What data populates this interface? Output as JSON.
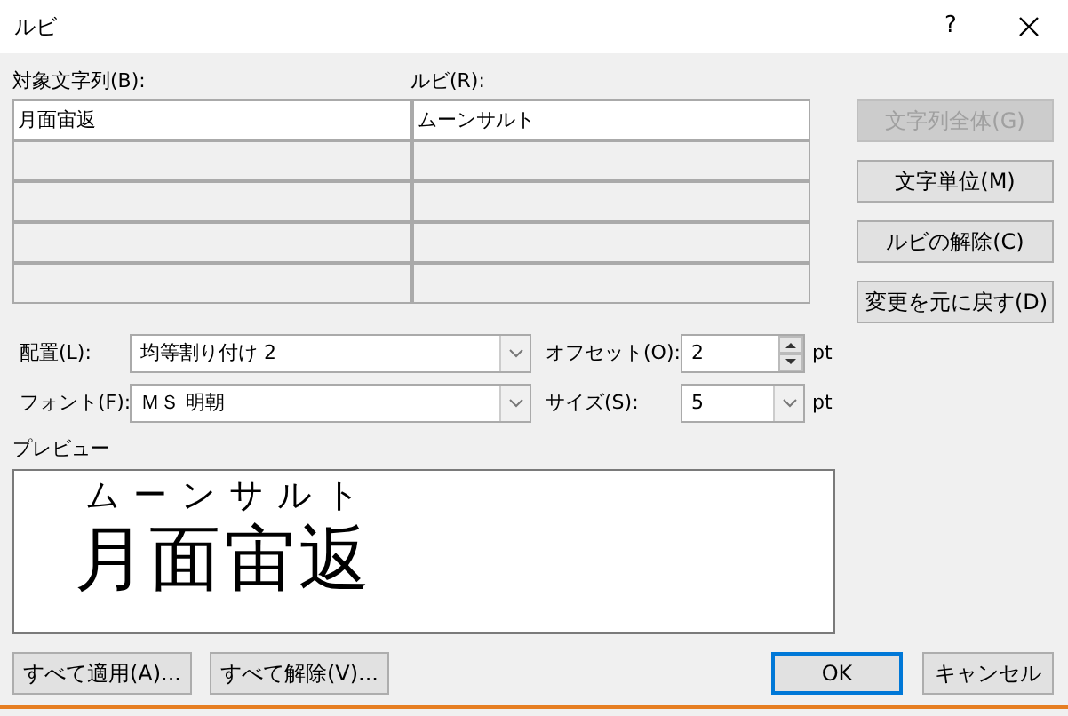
{
  "window": {
    "title": "ルビ",
    "help": "?"
  },
  "table": {
    "columns": [
      "対象文字列(B):",
      "ルビ(R):"
    ],
    "rows": [
      {
        "base": "月面宙返",
        "ruby": "ムーンサルト",
        "selected": true
      },
      {
        "selected": false
      },
      {
        "selected": false
      },
      {
        "selected": false
      },
      {
        "selected": false
      }
    ]
  },
  "side_buttons": [
    {
      "label": "文字列全体(G)",
      "disabled": true
    },
    {
      "label": "文字単位(M)",
      "disabled": false
    },
    {
      "label": "ルビの解除(C)",
      "disabled": false
    },
    {
      "label": "変更を元に戻す(D)",
      "disabled": false
    }
  ],
  "alignment": {
    "label": "配置(L):",
    "value": "均等割り付け 2"
  },
  "offset": {
    "label": "オフセット(O):",
    "value": "2",
    "unit": "pt"
  },
  "font": {
    "label": "フォント(F):",
    "value": "ＭＳ 明朝"
  },
  "size": {
    "label": "サイズ(S):",
    "value": "5",
    "unit": "pt"
  },
  "preview": {
    "label": "プレビュー",
    "ruby": "ムーンサルト",
    "base": "月面宙返"
  },
  "footer_buttons": [
    {
      "label": "すべて適用(A)...",
      "default": false
    },
    {
      "label": "すべて解除(V)...",
      "default": false
    },
    {
      "label": "OK",
      "default": true
    },
    {
      "label": "キャンセル",
      "default": false
    }
  ]
}
